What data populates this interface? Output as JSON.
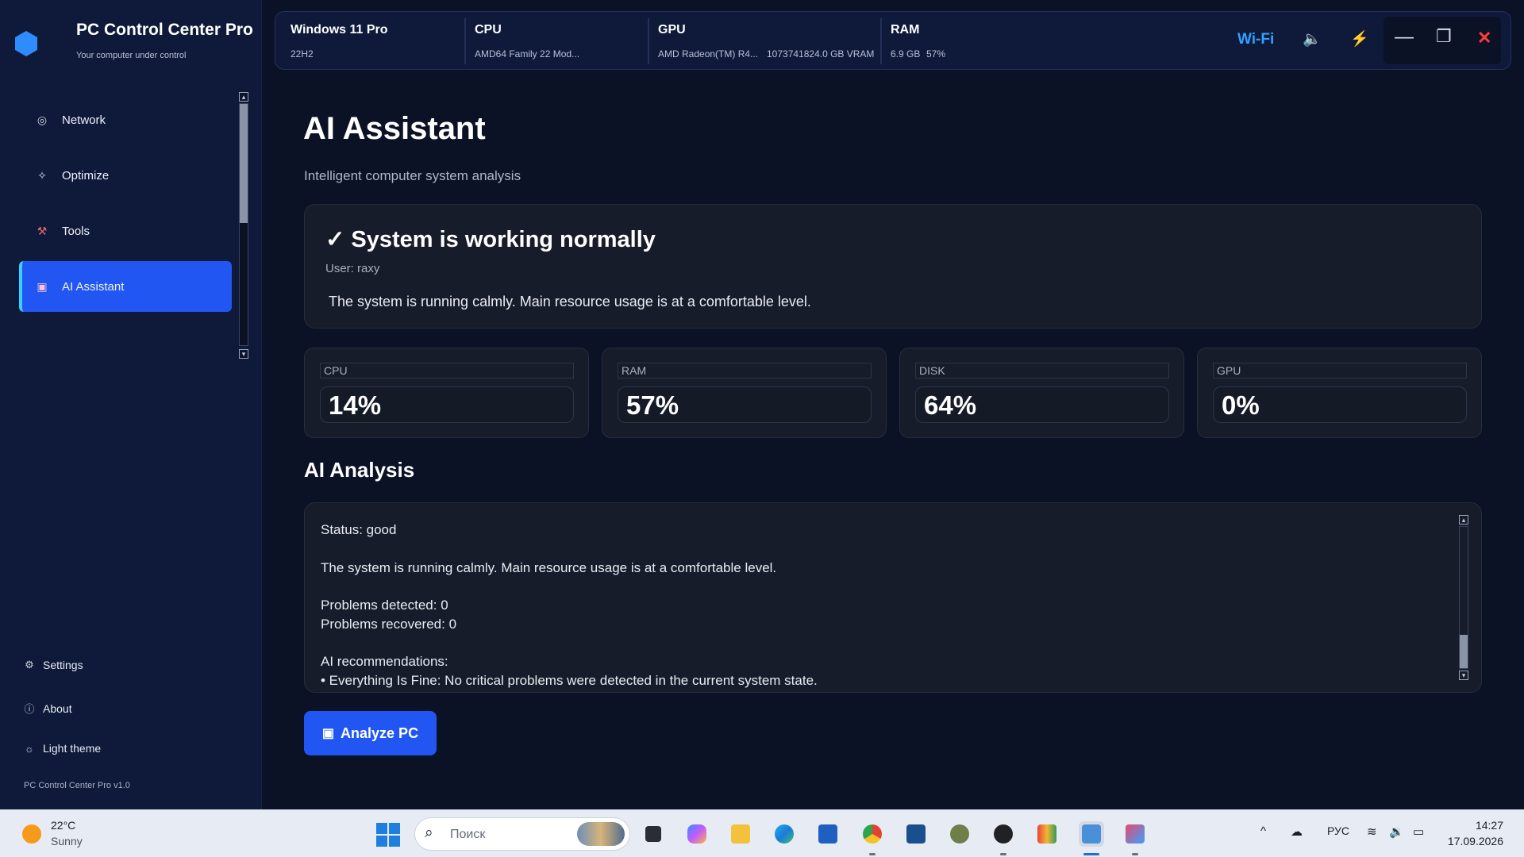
{
  "app": {
    "title": "PC Control Center Pro",
    "subtitle": "Your computer under control",
    "version": "PC Control Center Pro v1.0"
  },
  "sidebar": {
    "items": [
      {
        "label": "Network",
        "icon": "network-icon",
        "active": false
      },
      {
        "label": "Optimize",
        "icon": "sparkle-icon",
        "active": false
      },
      {
        "label": "Tools",
        "icon": "tools-icon",
        "active": false
      },
      {
        "label": "AI Assistant",
        "icon": "robot-icon",
        "active": true
      }
    ],
    "bottom": [
      {
        "label": "Settings",
        "icon": "gear-icon"
      },
      {
        "label": "About",
        "icon": "info-icon"
      },
      {
        "label": "Light theme",
        "icon": "sun-icon"
      }
    ]
  },
  "topbar": {
    "os": {
      "title": "Windows 11 Pro",
      "sub": "22H2"
    },
    "cpu": {
      "title": "CPU",
      "sub": "AMD64 Family 22 Mod..."
    },
    "gpu": {
      "title": "GPU",
      "sub": "AMD Radeon(TM) R4...",
      "vram": "1073741824.0 GB VRAM"
    },
    "ram": {
      "title": "RAM",
      "total": "6.9 GB",
      "usage": "57%"
    },
    "network": "Wi-Fi",
    "icons": [
      "speaker-icon",
      "power-bolt-icon",
      "minimize-icon",
      "maximize-icon",
      "close-icon"
    ]
  },
  "main": {
    "title": "AI Assistant",
    "subtitle": "Intelligent computer system analysis",
    "status": {
      "heading": "✓ System is working normally",
      "user": "User: raxy",
      "description": "The system is running calmly. Main resource usage is at a comfortable level."
    },
    "metrics": [
      {
        "label": "CPU",
        "value": "14%"
      },
      {
        "label": "RAM",
        "value": "57%"
      },
      {
        "label": "DISK",
        "value": "64%"
      },
      {
        "label": "GPU",
        "value": "0%"
      }
    ],
    "analysis_title": "AI Analysis",
    "analysis": {
      "status": "Status: good",
      "description": "The system is running calmly. Main resource usage is at a comfortable level.",
      "problems_detected": "Problems detected: 0",
      "problems_recovered": "Problems recovered: 0",
      "rec_title": "AI recommendations:",
      "rec_1": "• Everything Is Fine: No critical problems were detected in the current system state."
    },
    "analyze_button": "Analyze PC"
  },
  "taskbar": {
    "weather": {
      "temp": "22°C",
      "condition": "Sunny"
    },
    "search_placeholder": "Поиск",
    "language": "РУС",
    "time": "14:27",
    "date": "17.09.2026",
    "apps": [
      "file-explorer-icon",
      "copilot-icon",
      "folder-icon",
      "edge-icon",
      "store-icon",
      "chrome-icon",
      "app-icon",
      "settings-app-icon",
      "chatgpt-icon",
      "gmail-icon",
      "notepad-icon",
      "snipping-tool-icon"
    ]
  },
  "colors": {
    "accent": "#2156f3",
    "background": "#0b1226",
    "sidebar": "#0f1a3a",
    "card": "#171c2a",
    "wifi": "#2ea2ff",
    "close": "#ff3b3b",
    "bolt": "#ff8a1f"
  }
}
